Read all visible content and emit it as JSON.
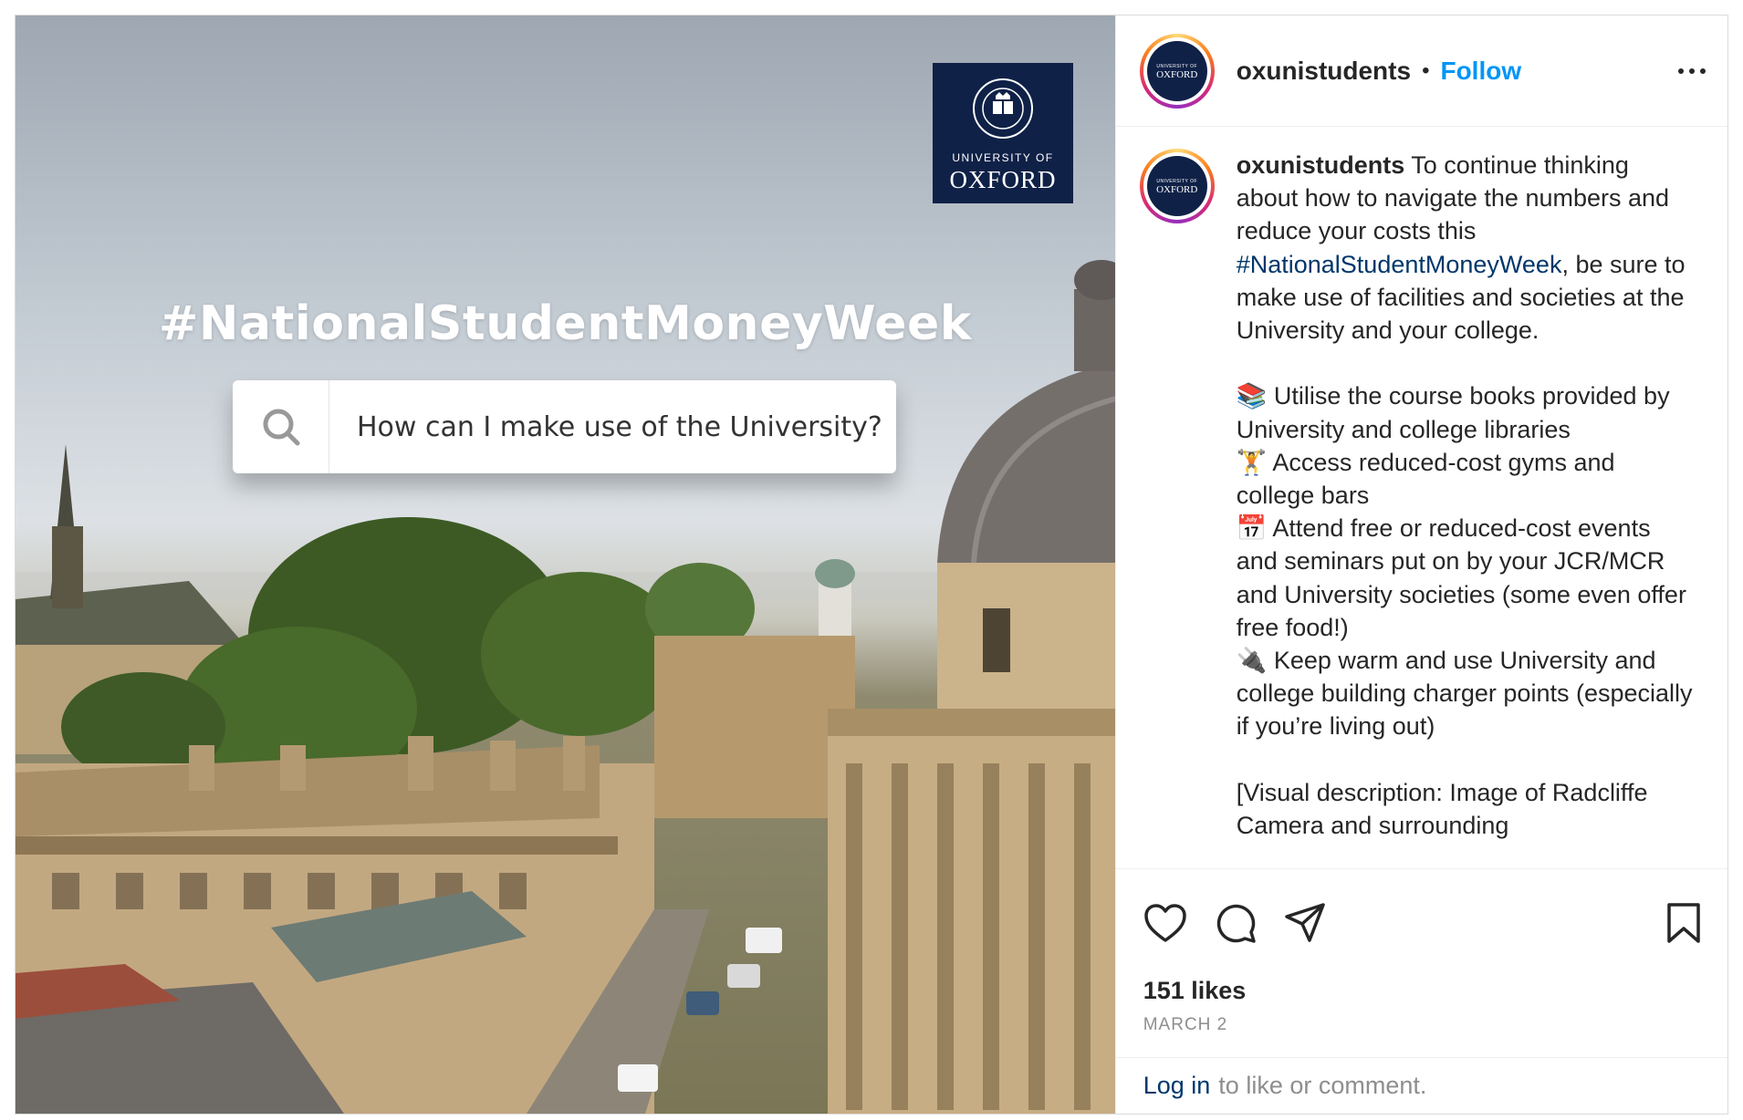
{
  "post": {
    "image": {
      "hashtag": "#NationalStudentMoneyWeek",
      "search_text": "How can I make use of the University?",
      "logo_line1": "UNIVERSITY OF",
      "logo_line2": "OXFORD"
    },
    "header": {
      "username": "oxunistudents",
      "separator": "•",
      "follow_label": "Follow",
      "avatar_line1": "UNIVERSITY OF",
      "avatar_line2": "OXFORD"
    },
    "caption": {
      "username": "oxunistudents",
      "text_before_tag": " To continue thinking about how to navigate the numbers and reduce your costs this ",
      "hashtag": "#NationalStudentMoneyWeek",
      "text_after_tag": ", be sure to make use of facilities and societies at the University and your college.\n\n📚 Utilise the course books provided by University and college libraries\n🏋️ Access reduced-cost gyms and college bars\n📅 Attend free or reduced-cost events and seminars put on by your JCR/MCR and University societies (some even offer free food!)\n🔌 Keep warm and use University and college building charger points (especially if you’re living out)\n\n[Visual description: Image of Radcliffe Camera and surrounding"
    },
    "actions": {
      "like_icon": "heart-icon",
      "comment_icon": "comment-icon",
      "share_icon": "paper-plane-icon",
      "save_icon": "bookmark-icon"
    },
    "likes": "151 likes",
    "date": "MARCH 2",
    "login": {
      "link": "Log in",
      "text": "to like or comment."
    },
    "colors": {
      "follow_blue": "#0095f6",
      "hashtag_link": "#00376b",
      "oxford_navy": "#0f2147"
    }
  }
}
